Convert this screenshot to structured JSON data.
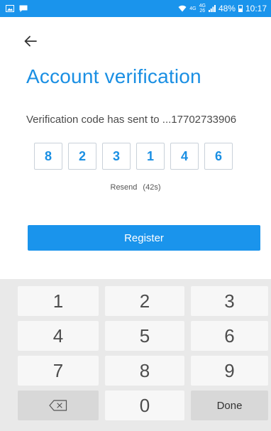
{
  "status_bar": {
    "network_top": "4G",
    "network_bottom": "4G",
    "network_sub": "26",
    "battery": "48%",
    "time": "10:17",
    "icons": [
      "image-notification-icon",
      "message-notification-icon",
      "wifi-icon",
      "signal-icon",
      "battery-icon"
    ]
  },
  "header": {
    "back_icon": "arrow-left-icon"
  },
  "page": {
    "title": "Account verification",
    "subtitle": "Verification code has sent to ...17702733906"
  },
  "code": {
    "digits": [
      "8",
      "2",
      "3",
      "1",
      "4",
      "6"
    ]
  },
  "resend": {
    "label": "Resend",
    "countdown": "(42s)"
  },
  "register": {
    "label": "Register"
  },
  "keypad": {
    "keys": [
      "1",
      "2",
      "3",
      "4",
      "5",
      "6",
      "7",
      "8",
      "9"
    ],
    "zero": "0",
    "done": "Done",
    "backspace_icon": "backspace-icon"
  },
  "colors": {
    "accent": "#1a94ec",
    "title": "#1a8fe3",
    "keypad_bg": "#e9e9e9"
  }
}
